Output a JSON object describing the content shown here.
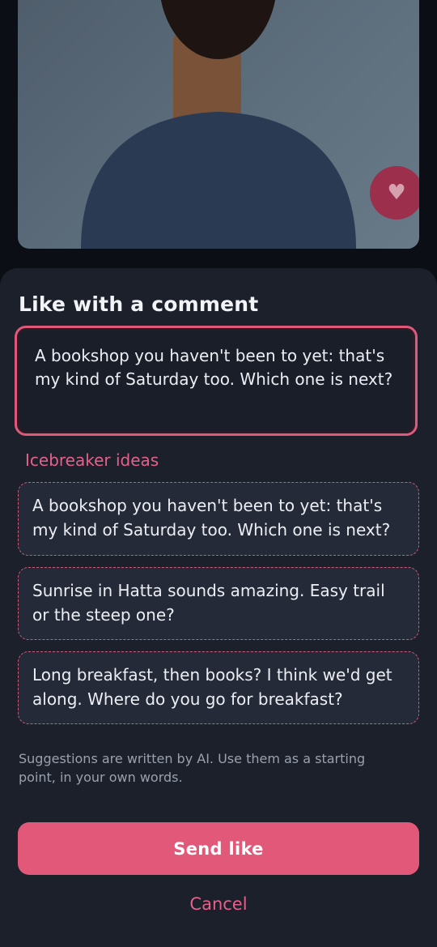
{
  "profile": {
    "photo_description_icon": "person-portrait",
    "like_icon": "heart-icon"
  },
  "sheet": {
    "title": "Like with a comment",
    "comment_value": "A bookshop you haven't been to yet: that's my kind of Saturday too. Which one is next?",
    "suggestions_label": "Icebreaker ideas",
    "suggestions": [
      "A bookshop you haven't been to yet: that's my kind of Saturday too. Which one is next?",
      "Sunrise in Hatta sounds amazing. Easy trail or the steep one?",
      "Long breakfast, then books? I think we'd get along. Where do you go for breakfast?"
    ],
    "disclaimer": "Suggestions are written by AI. Use them as a starting point, in your own words.",
    "send_label": "Send like",
    "cancel_label": "Cancel"
  },
  "colors": {
    "accent": "#e15879",
    "sheet_background": "#1b202b",
    "page_background": "#0b0f15"
  }
}
